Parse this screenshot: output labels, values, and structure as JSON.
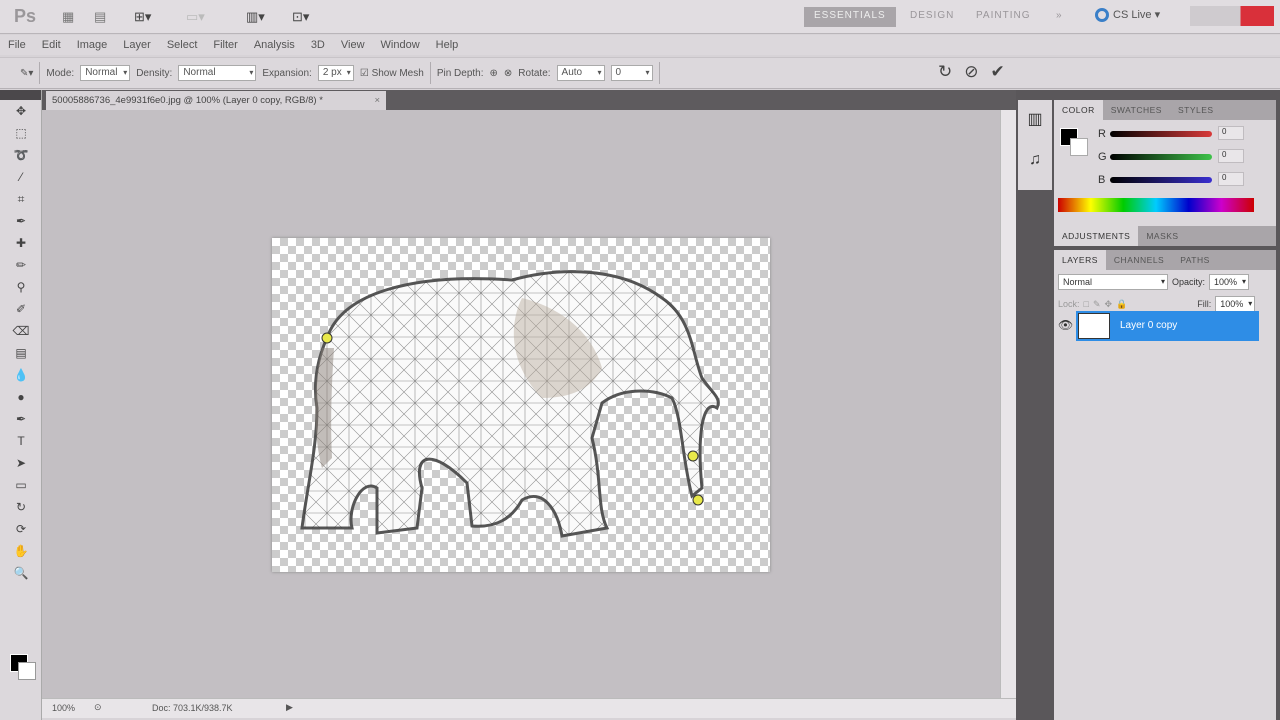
{
  "app": {
    "logo": "Ps",
    "workspaces": [
      "ESSENTIALS",
      "DESIGN",
      "PAINTING"
    ],
    "more": "»",
    "cs_live": "CS Live"
  },
  "menu": [
    "File",
    "Edit",
    "Image",
    "Layer",
    "Select",
    "Filter",
    "Analysis",
    "3D",
    "View",
    "Window",
    "Help"
  ],
  "options": {
    "mode_label": "Mode:",
    "mode": "Normal",
    "density_label": "Density:",
    "density": "Normal",
    "expansion_label": "Expansion:",
    "expansion": "2 px",
    "show_mesh": "Show Mesh",
    "pin_depth": "Pin Depth:",
    "rotate_label": "Rotate:",
    "rotate": "Auto",
    "angle": "0"
  },
  "document": {
    "tab_title": "50005886736_4e9931f6e0.jpg @ 100% (Layer 0 copy, RGB/8) *",
    "close": "×",
    "zoom": "100%",
    "doc_info": "Doc: 703.1K/938.7K"
  },
  "color_panel": {
    "tabs": [
      "COLOR",
      "SWATCHES",
      "STYLES"
    ],
    "channels": [
      {
        "label": "R",
        "value": "0",
        "color": "#d93a3a"
      },
      {
        "label": "G",
        "value": "0",
        "color": "#3ec24a"
      },
      {
        "label": "B",
        "value": "0",
        "color": "#3a2fd0"
      }
    ]
  },
  "adjust_panel": {
    "tabs": [
      "ADJUSTMENTS",
      "MASKS"
    ]
  },
  "layers_panel": {
    "tabs": [
      "LAYERS",
      "CHANNELS",
      "PATHS"
    ],
    "blend": "Normal",
    "opacity_label": "Opacity:",
    "opacity": "100%",
    "lock_label": "Lock:",
    "fill_label": "Fill:",
    "fill": "100%",
    "layers": [
      {
        "name": "Layer 0 copy",
        "visible": true,
        "selected": true
      }
    ]
  },
  "colors": {
    "selection": "#2e8de6"
  }
}
